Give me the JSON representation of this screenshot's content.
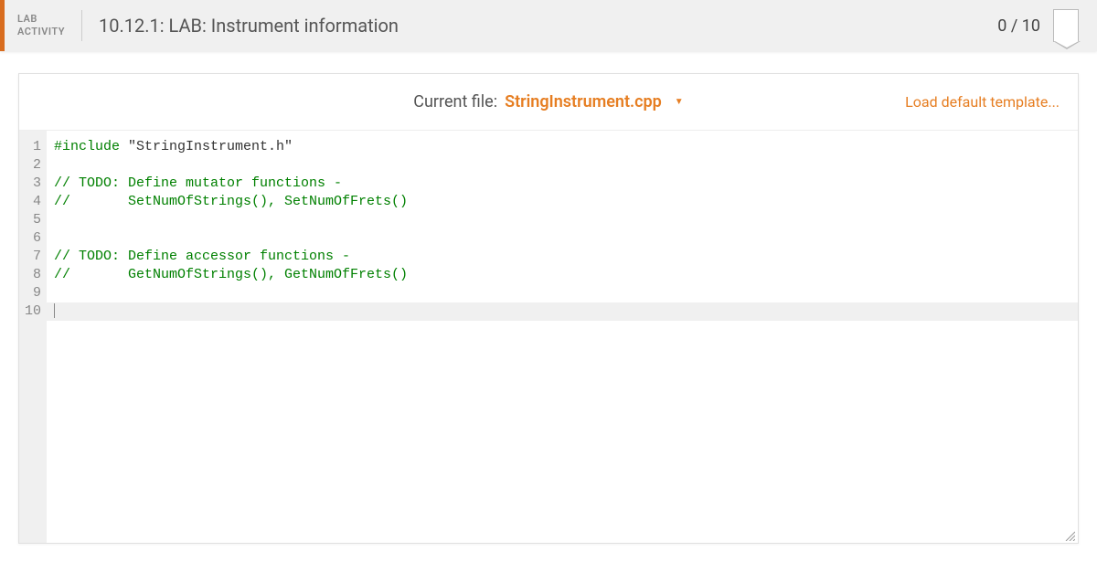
{
  "header": {
    "activity_label": "LAB\nACTIVITY",
    "title": "10.12.1: LAB: Instrument information",
    "score": "0 / 10"
  },
  "editor": {
    "current_file_label": "Current file:",
    "current_file_name": "StringInstrument.cpp",
    "load_template": "Load default template...",
    "lines": [
      {
        "n": "1",
        "tokens": [
          {
            "cls": "tok-pp",
            "t": "#include "
          },
          {
            "cls": "tok-str",
            "t": "\"StringInstrument.h\""
          }
        ]
      },
      {
        "n": "2",
        "tokens": []
      },
      {
        "n": "3",
        "tokens": [
          {
            "cls": "tok-comment",
            "t": "// TODO: Define mutator functions - "
          }
        ]
      },
      {
        "n": "4",
        "tokens": [
          {
            "cls": "tok-comment",
            "t": "//       SetNumOfStrings(), SetNumOfFrets()"
          }
        ]
      },
      {
        "n": "5",
        "tokens": []
      },
      {
        "n": "6",
        "tokens": []
      },
      {
        "n": "7",
        "tokens": [
          {
            "cls": "tok-comment",
            "t": "// TODO: Define accessor functions -"
          }
        ]
      },
      {
        "n": "8",
        "tokens": [
          {
            "cls": "tok-comment",
            "t": "//       GetNumOfStrings(), GetNumOfFrets()"
          }
        ]
      },
      {
        "n": "9",
        "tokens": []
      },
      {
        "n": "10",
        "tokens": [],
        "highlight": true,
        "cursor": true
      }
    ]
  }
}
